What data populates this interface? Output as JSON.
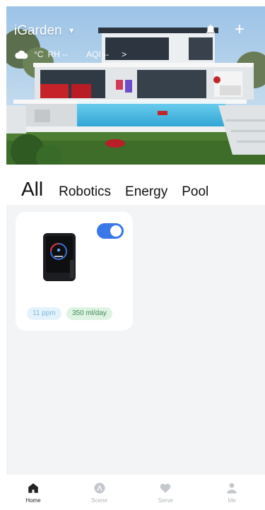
{
  "header": {
    "home_name": "iGarden",
    "weather_icon": "cloud-icon",
    "temperature": "°C",
    "humidity": "RH --",
    "aqi": "AQI --"
  },
  "tabs": [
    {
      "label": "All",
      "active": true
    },
    {
      "label": "Robotics",
      "active": false
    },
    {
      "label": "Energy",
      "active": false
    },
    {
      "label": "Pool",
      "active": false
    }
  ],
  "device_card": {
    "enabled": true,
    "ppm": "11 ppm",
    "flow": "350 ml/day"
  },
  "bottom_nav": [
    {
      "label": "Home",
      "icon": "home-icon",
      "active": true
    },
    {
      "label": "Scene",
      "icon": "scene-icon",
      "active": false
    },
    {
      "label": "Serve",
      "icon": "heart-icon",
      "active": false
    },
    {
      "label": "Me",
      "icon": "person-icon",
      "active": false
    }
  ],
  "colors": {
    "accent": "#3a77e8",
    "ppm_badge_bg": "#e4f3fb",
    "flow_badge_bg": "#dff3e3"
  }
}
